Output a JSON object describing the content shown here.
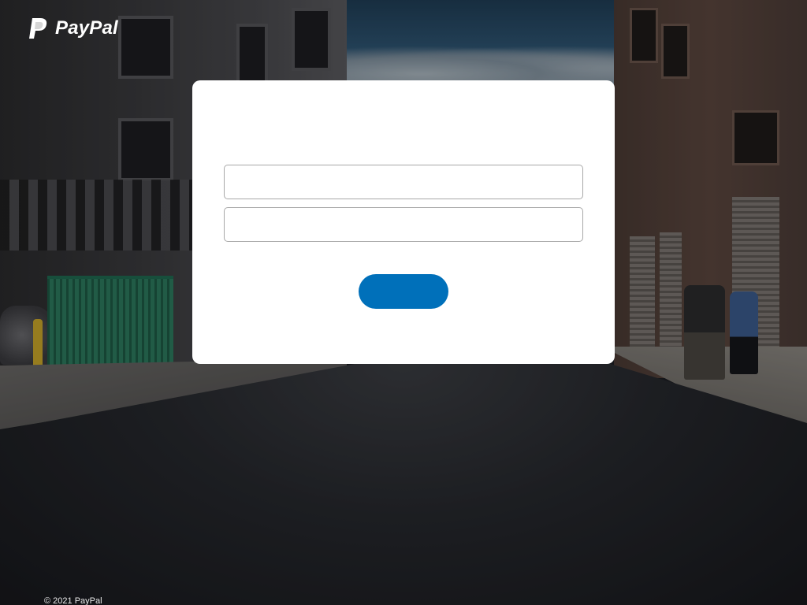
{
  "brand": {
    "logo_text": "PayPal",
    "logo_icon": "paypal-p-icon",
    "accent_color": "#0070ba"
  },
  "login_form": {
    "email_placeholder": "",
    "email_value": "",
    "password_placeholder": "",
    "password_value": "",
    "submit_label": ""
  },
  "footer": {
    "copyright": "© 2021 PayPal"
  }
}
